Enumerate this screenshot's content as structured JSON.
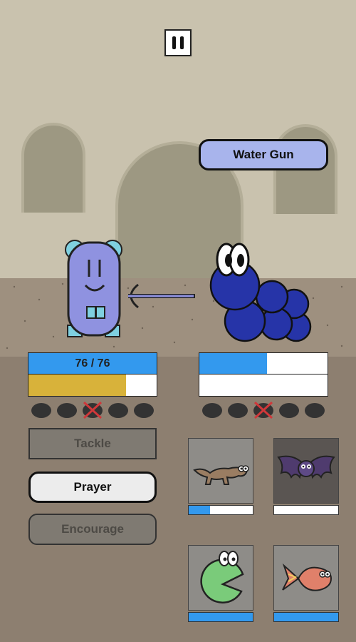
{
  "hud": {
    "pause_icon": "pause-icon"
  },
  "battle": {
    "move_name": "Water Gun",
    "player": {
      "hp_text": "76 / 76",
      "hp_fraction": 1.0,
      "energy_fraction": 0.76,
      "pips": [
        "filled",
        "filled",
        "crossed",
        "filled",
        "filled"
      ]
    },
    "enemy": {
      "hp_fraction": 0.53,
      "energy_fraction": 0.0,
      "pips": [
        "filled",
        "filled",
        "crossed",
        "filled",
        "filled"
      ]
    }
  },
  "actions": {
    "tackle": "Tackle",
    "prayer": "Prayer",
    "encourage": "Encourage"
  },
  "bench": [
    {
      "icon": "lizard-icon",
      "hp_fraction": 0.33
    },
    {
      "icon": "bat-icon",
      "hp_fraction": 0.0
    },
    {
      "icon": "chomper-icon",
      "hp_fraction": 1.0
    },
    {
      "icon": "fish-icon",
      "hp_fraction": 1.0
    }
  ],
  "colors": {
    "hp": "#3399ee",
    "energy": "#d8b23a",
    "player_creature": "#8f92e0",
    "enemy_creature": "#2634a8"
  }
}
